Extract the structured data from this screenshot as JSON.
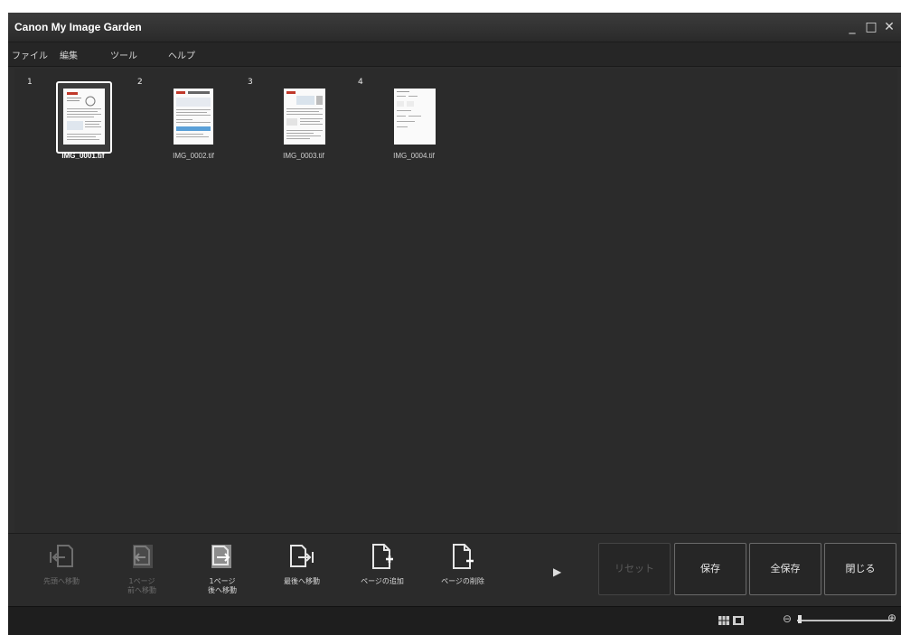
{
  "window": {
    "title": "Canon My Image Garden",
    "controls": {
      "minimize": "_",
      "maximize": "□",
      "close": "✕"
    }
  },
  "menu": [
    "ファイル",
    "編集",
    "ツール",
    "ヘルプ"
  ],
  "thumbnails": [
    {
      "index": "1",
      "name": "IMG_0001.tif",
      "selected": true
    },
    {
      "index": "2",
      "name": "IMG_0002.tif",
      "selected": false
    },
    {
      "index": "3",
      "name": "IMG_0003.tif",
      "selected": false
    },
    {
      "index": "4",
      "name": "IMG_0004.tif",
      "selected": false
    }
  ],
  "toolbar": {
    "buttons": [
      {
        "label": "先頭へ移動",
        "enabled": false,
        "icon": "move-to-first-icon"
      },
      {
        "label": "1ページ\n前へ移動",
        "enabled": false,
        "icon": "move-back-icon"
      },
      {
        "label": "1ページ\n後へ移動",
        "enabled": true,
        "icon": "move-forward-icon"
      },
      {
        "label": "最後へ移動",
        "enabled": true,
        "icon": "move-to-last-icon"
      },
      {
        "label": "ページの追加",
        "enabled": true,
        "icon": "add-page-icon"
      },
      {
        "label": "ページの削除",
        "enabled": true,
        "icon": "delete-page-icon"
      }
    ],
    "expand_icon": "▶",
    "actions": {
      "reset": "リセット",
      "save": "保存",
      "save_all": "全保存",
      "close": "閉じる"
    }
  },
  "statusbar": {
    "view_icons": [
      "grid-view-icon",
      "single-view-icon"
    ],
    "zoom_out": "⊖",
    "zoom_in": "⊕"
  }
}
